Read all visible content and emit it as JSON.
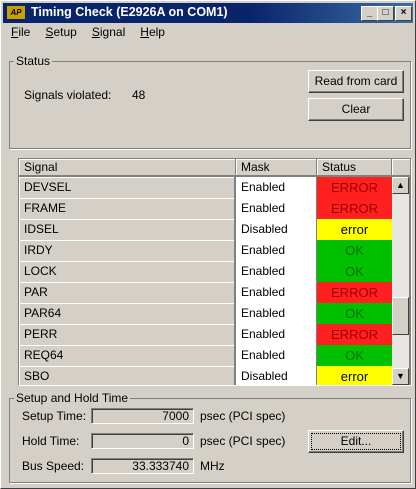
{
  "window": {
    "title": "Timing Check (E2926A on COM1)",
    "app_icon_text": "AP"
  },
  "titlebar_buttons": {
    "minimize": "_",
    "maximize": "□",
    "close": "×"
  },
  "menu": [
    {
      "label": "File",
      "mnemonic": "F",
      "rest": "ile"
    },
    {
      "label": "Setup",
      "mnemonic": "S",
      "rest": "etup"
    },
    {
      "label": "Signal",
      "mnemonic": "S",
      "rest": "ignal"
    },
    {
      "label": "Help",
      "mnemonic": "H",
      "rest": "elp"
    }
  ],
  "status": {
    "group_label": "Status",
    "signals_violated_label": "Signals violated:",
    "signals_violated_value": "48",
    "read_button": "Read from card",
    "clear_button": "Clear"
  },
  "table": {
    "headers": {
      "signal": "Signal",
      "mask": "Mask",
      "status": "Status"
    },
    "rows": [
      {
        "signal": "DEVSEL",
        "mask": "Enabled",
        "status": "ERROR",
        "color": "#ff2020",
        "text_color": "#a00000"
      },
      {
        "signal": "FRAME",
        "mask": "Enabled",
        "status": "ERROR",
        "color": "#ff2020",
        "text_color": "#a00000"
      },
      {
        "signal": "IDSEL",
        "mask": "Disabled",
        "status": "error",
        "color": "#ffff00",
        "text_color": "#000000"
      },
      {
        "signal": "IRDY",
        "mask": "Enabled",
        "status": "OK",
        "color": "#00c000",
        "text_color": "#007000"
      },
      {
        "signal": "LOCK",
        "mask": "Enabled",
        "status": "OK",
        "color": "#00c000",
        "text_color": "#007000"
      },
      {
        "signal": "PAR",
        "mask": "Enabled",
        "status": "ERROR",
        "color": "#ff2020",
        "text_color": "#a00000"
      },
      {
        "signal": "PAR64",
        "mask": "Enabled",
        "status": "OK",
        "color": "#00c000",
        "text_color": "#007000"
      },
      {
        "signal": "PERR",
        "mask": "Enabled",
        "status": "ERROR",
        "color": "#ff2020",
        "text_color": "#a00000"
      },
      {
        "signal": "REQ64",
        "mask": "Enabled",
        "status": "OK",
        "color": "#00c000",
        "text_color": "#007000"
      },
      {
        "signal": "SBO",
        "mask": "Disabled",
        "status": "error",
        "color": "#ffff00",
        "text_color": "#000000"
      }
    ],
    "scroll_fraction": 0.75
  },
  "setup_hold": {
    "group_label": "Setup and Hold Time",
    "setup_label": "Setup Time:",
    "setup_value": "7000",
    "setup_unit": "psec  (PCI spec)",
    "hold_label": "Hold Time:",
    "hold_value": "0",
    "hold_unit": "psec  (PCI spec)",
    "bus_label": "Bus Speed:",
    "bus_value": "33.333740",
    "bus_unit": "MHz",
    "edit_button": "Edit..."
  }
}
